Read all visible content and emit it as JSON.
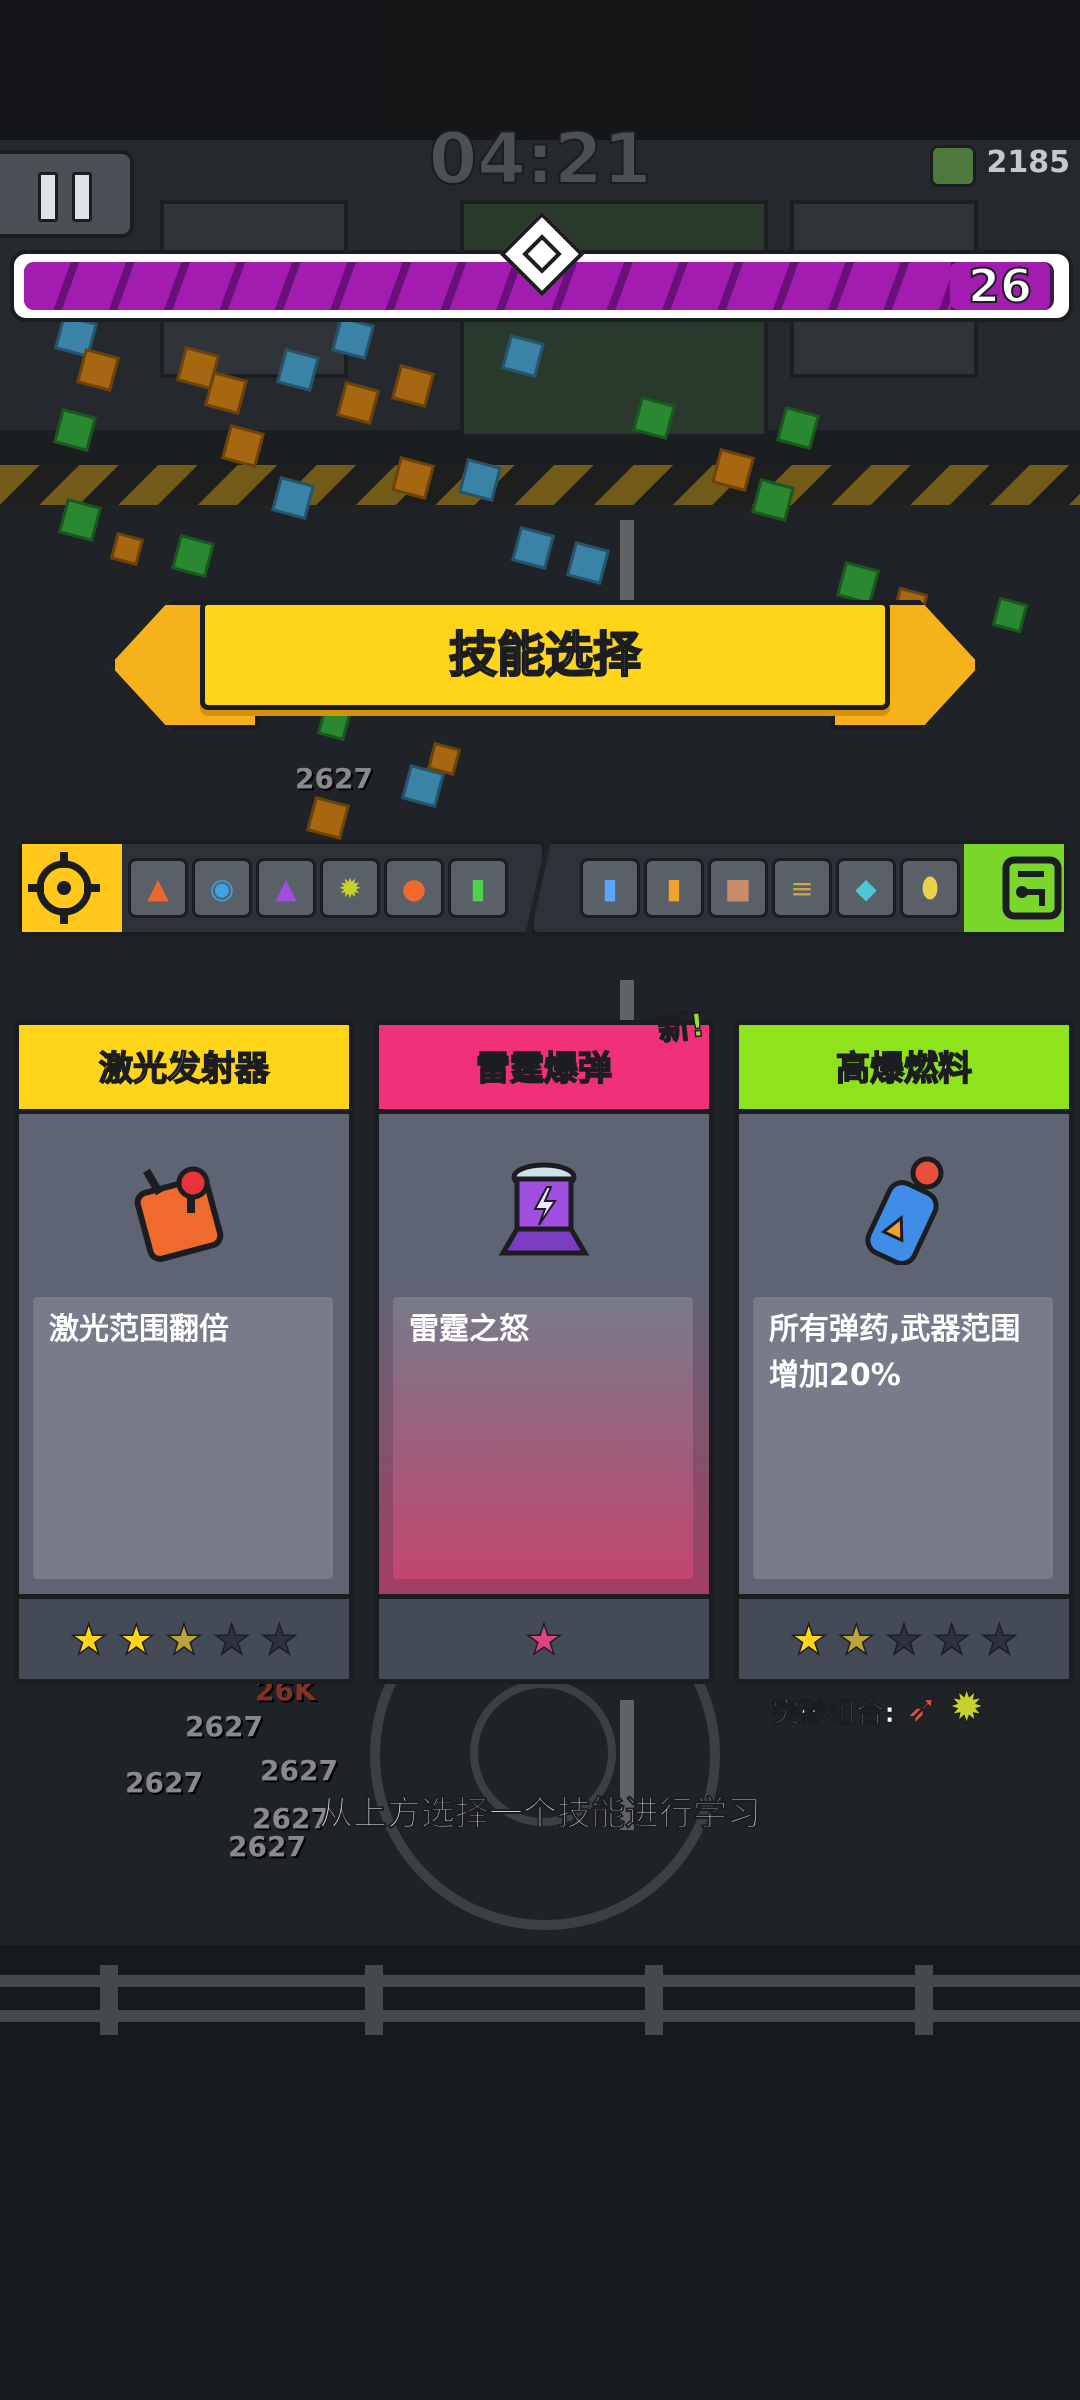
{
  "hud": {
    "timer": "04:21",
    "coins": "2185",
    "level": "26",
    "xp_progress": 0.9
  },
  "banner": {
    "title": "技能选择"
  },
  "inventory": {
    "weapons": [
      "missile-icon",
      "disc-icon",
      "cone-turret-icon",
      "spiky-mine-icon",
      "fire-bomb-icon",
      "green-bottle-icon"
    ],
    "items": [
      "blue-bottle-icon",
      "battery-icon",
      "book-icon",
      "ammo-belt-icon",
      "map-icon",
      "capsule-icon"
    ]
  },
  "cards": [
    {
      "title": "激光发射器",
      "desc": "激光范围翻倍",
      "icon": "laser-joystick-icon",
      "header_color": "#ffd51a",
      "stars": [
        "on",
        "on",
        "half",
        "off",
        "off"
      ]
    },
    {
      "title": "雷霆爆弹",
      "desc": "雷霆之怒",
      "icon": "thunder-bomb-icon",
      "header_color": "#f0317a",
      "stars": [
        "pink"
      ],
      "new_label": "新!"
    },
    {
      "title": "高爆燃料",
      "desc": "所有弹药,武器范围增加20%",
      "icon": "fuel-canister-icon",
      "header_color": "#8fe21c",
      "stars": [
        "on",
        "half",
        "off",
        "off",
        "off"
      ]
    }
  ],
  "combo": {
    "label": "突破组合:",
    "items": [
      "rocket-icon",
      "spiky-mine-icon"
    ]
  },
  "hint": "从上方选择一个技能进行学习",
  "damage_numbers": [
    "2627",
    "2627",
    "2627",
    "2627",
    "2627",
    "2627",
    "26K"
  ]
}
